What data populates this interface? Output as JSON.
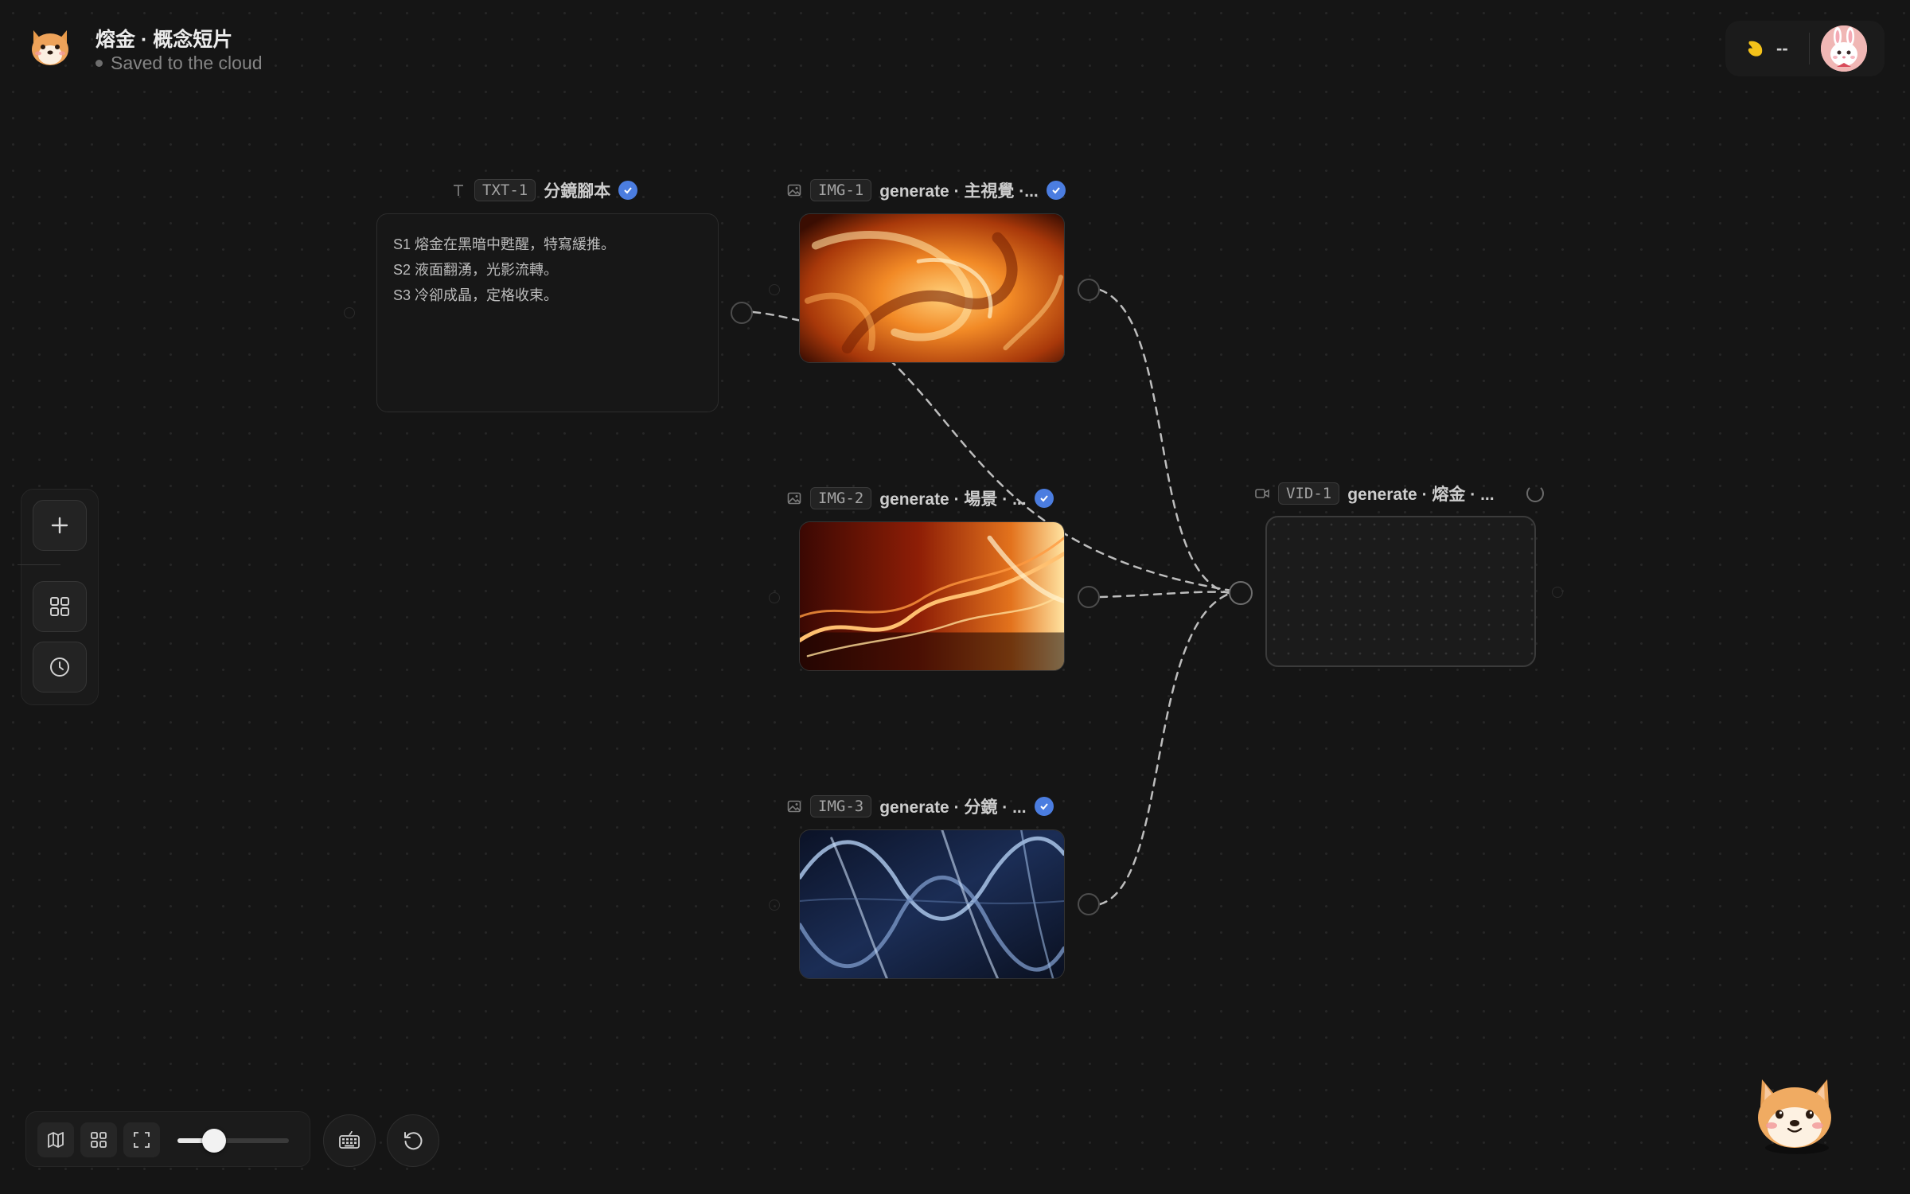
{
  "header": {
    "title": "熔金 · 概念短片",
    "status": "Saved to the cloud",
    "credits": "--"
  },
  "nodes": {
    "txt1": {
      "id": "TXT-1",
      "title": "分鏡腳本",
      "lines": [
        "S1 熔金在黑暗中甦醒，特寫緩推。",
        "S2 液面翻湧，光影流轉。",
        "S3 冷卻成晶，定格收束。"
      ]
    },
    "img1": {
      "id": "IMG-1",
      "title": "generate · 主視覺 ·..."
    },
    "img2": {
      "id": "IMG-2",
      "title": "generate · 場景 · ..."
    },
    "img3": {
      "id": "IMG-3",
      "title": "generate · 分鏡 · ..."
    },
    "vid1": {
      "id": "VID-1",
      "title": "generate · 熔金 · ..."
    }
  },
  "zoom": {
    "level": 0.33
  },
  "colors": {
    "background": "#151515",
    "accent_check": "#4b7de0",
    "coin": "#f4c21a"
  },
  "icons": {
    "text_node": "text-type-icon",
    "image_node": "image-icon",
    "video_node": "video-camera-icon",
    "add": "plus-icon",
    "apps": "grid-icon",
    "history": "clock-icon",
    "map": "map-icon",
    "fit": "expand-icon",
    "keyboard": "keyboard-icon",
    "reset": "rotate-ccw-icon"
  }
}
